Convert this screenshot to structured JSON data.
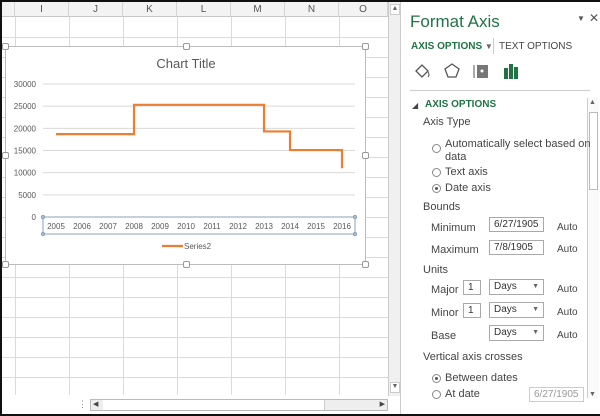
{
  "sheet": {
    "columns": [
      "I",
      "J",
      "K",
      "L",
      "M",
      "N",
      "O"
    ]
  },
  "chart_data": {
    "type": "line",
    "title": "Chart Title",
    "categories": [
      "2005",
      "2006",
      "2007",
      "2008",
      "2009",
      "2010",
      "2011",
      "2012",
      "2013",
      "2014",
      "2015",
      "2016"
    ],
    "series": [
      {
        "name": "Series2",
        "color": "#ED7D31",
        "points": [
          [
            2005,
            18700
          ],
          [
            2008,
            18700
          ],
          [
            2008,
            25300
          ],
          [
            2013,
            25300
          ],
          [
            2013,
            19300
          ],
          [
            2014,
            19300
          ],
          [
            2014,
            15100
          ],
          [
            2016,
            15100
          ],
          [
            2016,
            11000
          ]
        ]
      }
    ],
    "yticks": [
      "0",
      "5000",
      "10000",
      "15000",
      "20000",
      "25000",
      "30000"
    ],
    "ylim": [
      0,
      30000
    ],
    "grid": true,
    "legend": "bottom"
  },
  "pane": {
    "title": "Format Axis",
    "tab_axis": "AXIS OPTIONS",
    "tab_text": "TEXT OPTIONS",
    "section": "AXIS OPTIONS",
    "axis_type": "Axis Type",
    "opt_auto": "Automatically select based on",
    "opt_auto2": "data",
    "opt_text": "Text axis",
    "opt_date": "Date axis",
    "bounds": "Bounds",
    "minimum": "Minimum",
    "min_val": "6/27/1905",
    "maximum": "Maximum",
    "max_val": "7/8/1905",
    "units": "Units",
    "major": "Major",
    "major_val": "1",
    "major_unit": "Days",
    "minor": "Minor",
    "minor_val": "1",
    "minor_unit": "Days",
    "base": "Base",
    "base_unit": "Days",
    "auto": "Auto",
    "vcross": "Vertical axis crosses",
    "between": "Between dates",
    "atdate": "At date",
    "atdate_val": "6/27/1905",
    "accent": "#217346"
  }
}
